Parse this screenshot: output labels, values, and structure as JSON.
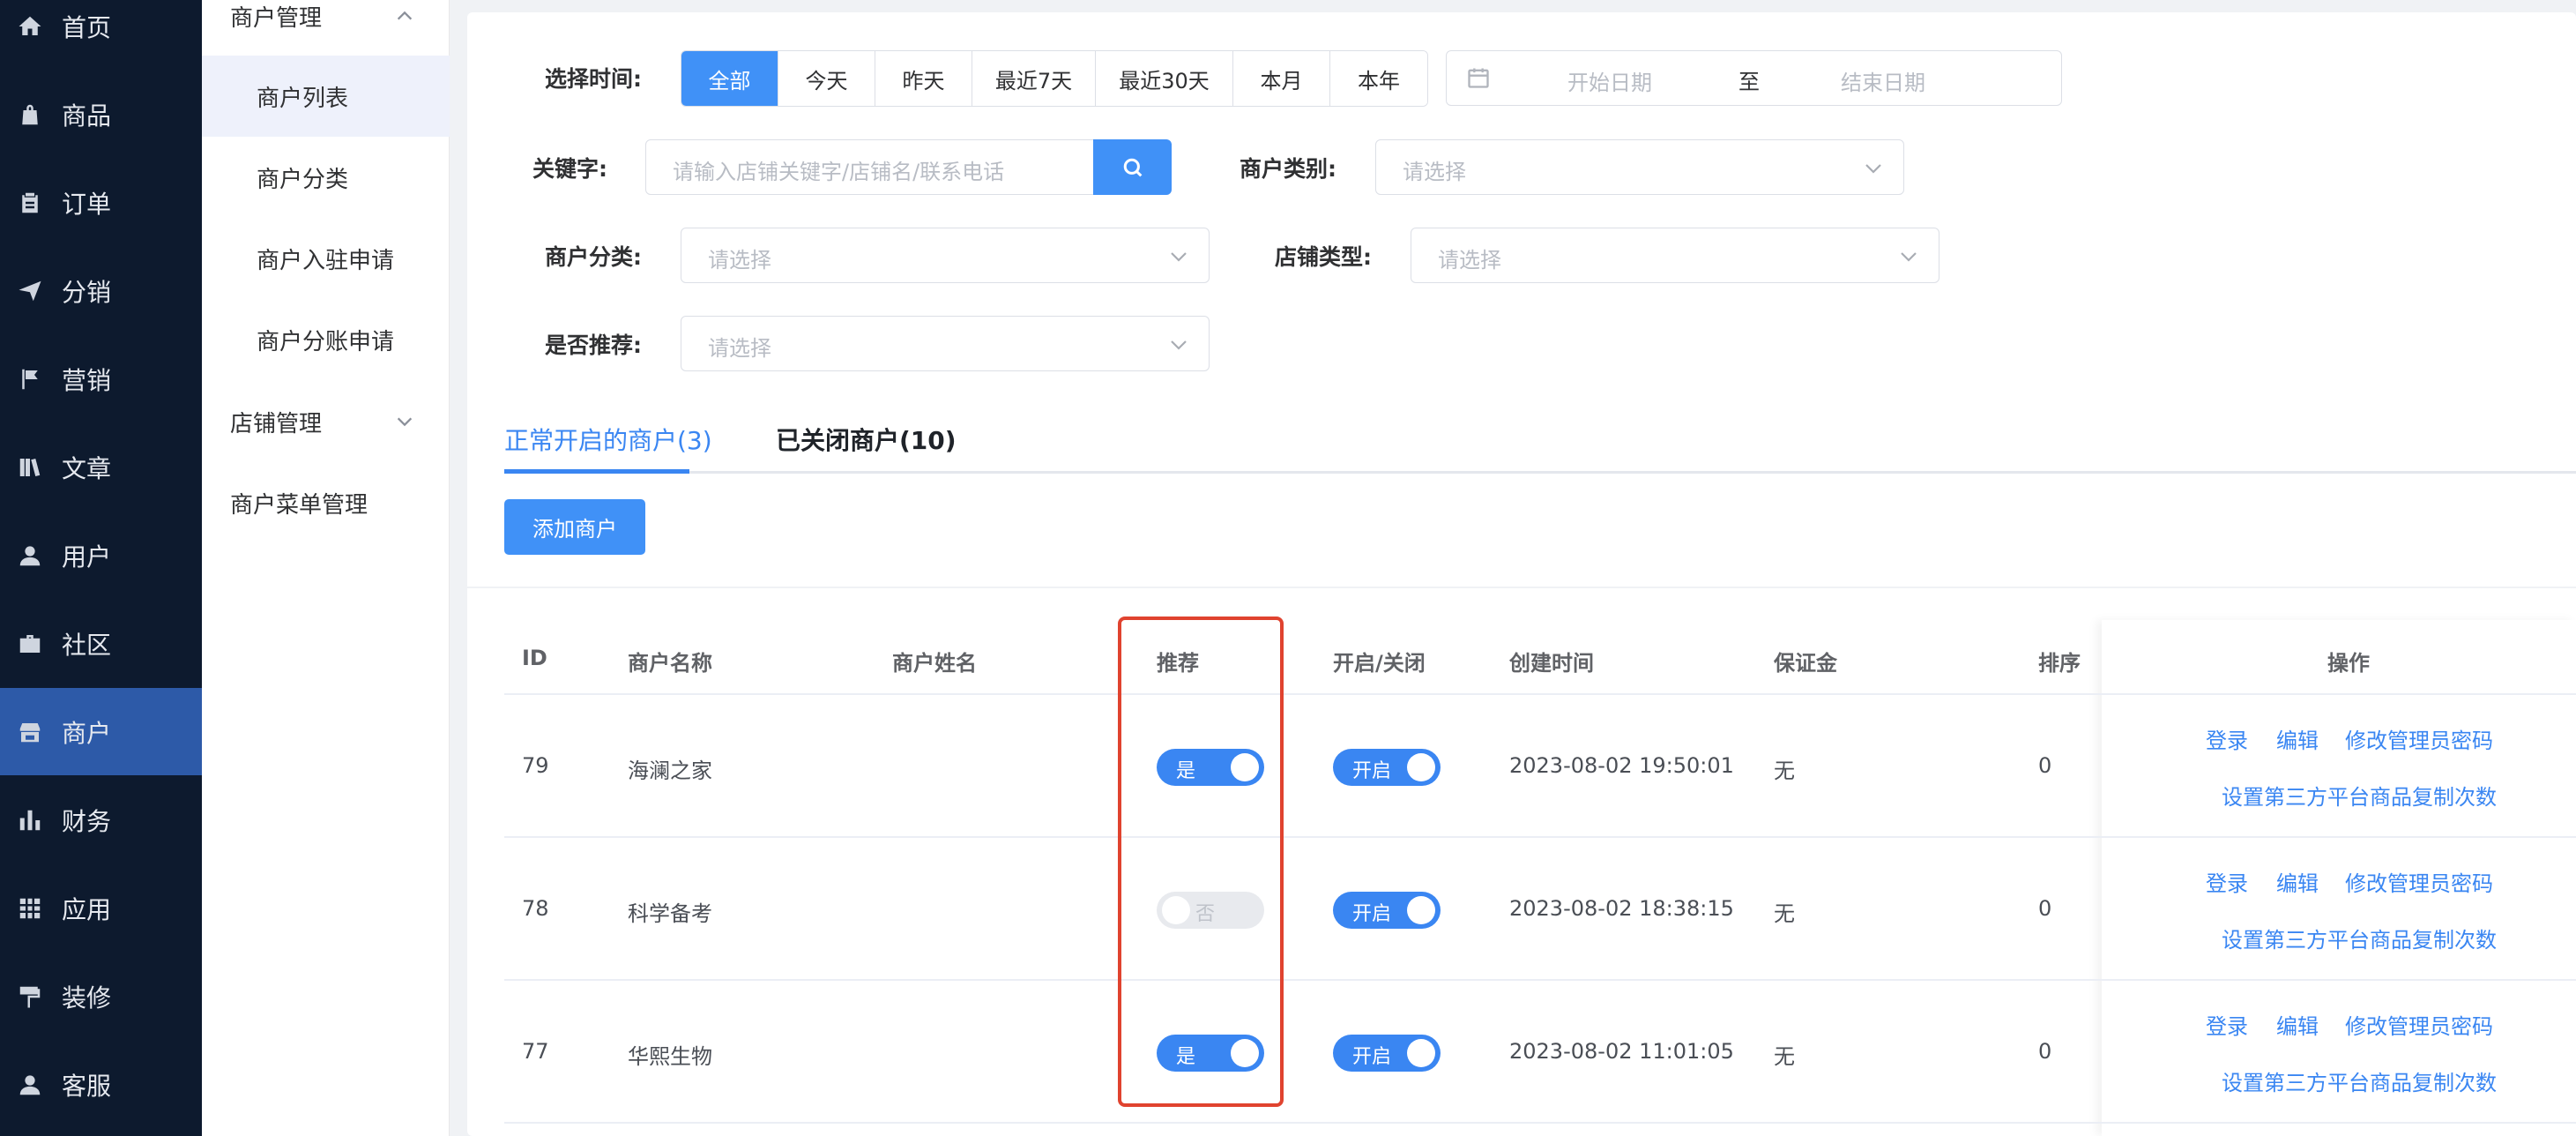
{
  "nav": {
    "items": [
      {
        "label": "首页",
        "icon": "home-icon"
      },
      {
        "label": "商品",
        "icon": "bag-icon"
      },
      {
        "label": "订单",
        "icon": "clipboard-icon"
      },
      {
        "label": "分销",
        "icon": "send-icon"
      },
      {
        "label": "营销",
        "icon": "flag-icon"
      },
      {
        "label": "文章",
        "icon": "book-icon"
      },
      {
        "label": "用户",
        "icon": "user-icon"
      },
      {
        "label": "社区",
        "icon": "briefcase-icon"
      },
      {
        "label": "商户",
        "icon": "shop-icon"
      },
      {
        "label": "财务",
        "icon": "bar-chart-icon"
      },
      {
        "label": "应用",
        "icon": "grid-icon"
      },
      {
        "label": "装修",
        "icon": "paint-roller-icon"
      },
      {
        "label": "客服",
        "icon": "headset-user-icon"
      }
    ],
    "active": "商户"
  },
  "subnav": {
    "group1": "商户管理",
    "items": [
      "商户列表",
      "商户分类",
      "商户入驻申请",
      "商户分账申请"
    ],
    "active": "商户列表",
    "group2": "店铺管理",
    "group3": "商户菜单管理"
  },
  "filters": {
    "time_label": "选择时间:",
    "time_options": [
      "全部",
      "今天",
      "昨天",
      "最近7天",
      "最近30天",
      "本月",
      "本年"
    ],
    "time_selected": "全部",
    "start_placeholder": "开始日期",
    "to": "至",
    "end_placeholder": "结束日期",
    "keyword_label": "关键字:",
    "keyword_placeholder": "请输入店铺关键字/店铺名/联系电话",
    "merchant_type_label": "商户类别:",
    "merchant_category_label": "商户分类:",
    "store_type_label": "店铺类型:",
    "recommend_label": "是否推荐:",
    "select_placeholder": "请选择"
  },
  "tabs": {
    "open": "正常开启的商户(3)",
    "closed": "已关闭商户(10)",
    "active": "open"
  },
  "add_button": "添加商户",
  "table": {
    "headers": {
      "id": "ID",
      "name": "商户名称",
      "person": "商户姓名",
      "recommend": "推荐",
      "toggle": "开启/关闭",
      "created": "创建时间",
      "deposit": "保证金",
      "sort": "排序",
      "ops": "操作"
    },
    "rows": [
      {
        "id": "79",
        "name": "海澜之家",
        "person": "",
        "recommend": true,
        "recommend_text": "是",
        "open": true,
        "open_text": "开启",
        "created": "2023-08-02 19:50:01",
        "deposit": "无",
        "sort": "0"
      },
      {
        "id": "78",
        "name": "科学备考",
        "person": "",
        "recommend": false,
        "recommend_text": "否",
        "open": true,
        "open_text": "开启",
        "created": "2023-08-02 18:38:15",
        "deposit": "无",
        "sort": "0"
      },
      {
        "id": "77",
        "name": "华熙生物",
        "person": "",
        "recommend": true,
        "recommend_text": "是",
        "open": true,
        "open_text": "开启",
        "created": "2023-08-02 11:01:05",
        "deposit": "无",
        "sort": "0"
      }
    ],
    "ops": {
      "login": "登录",
      "edit": "编辑",
      "change_pwd": "修改管理员密码",
      "set_copy": "设置第三方平台商品复制次数"
    }
  },
  "colors": {
    "nav_bg": "#0d1a2e",
    "nav_active": "#2d5aa8",
    "primary": "#4091f7",
    "highlight_box": "#e0432f"
  }
}
